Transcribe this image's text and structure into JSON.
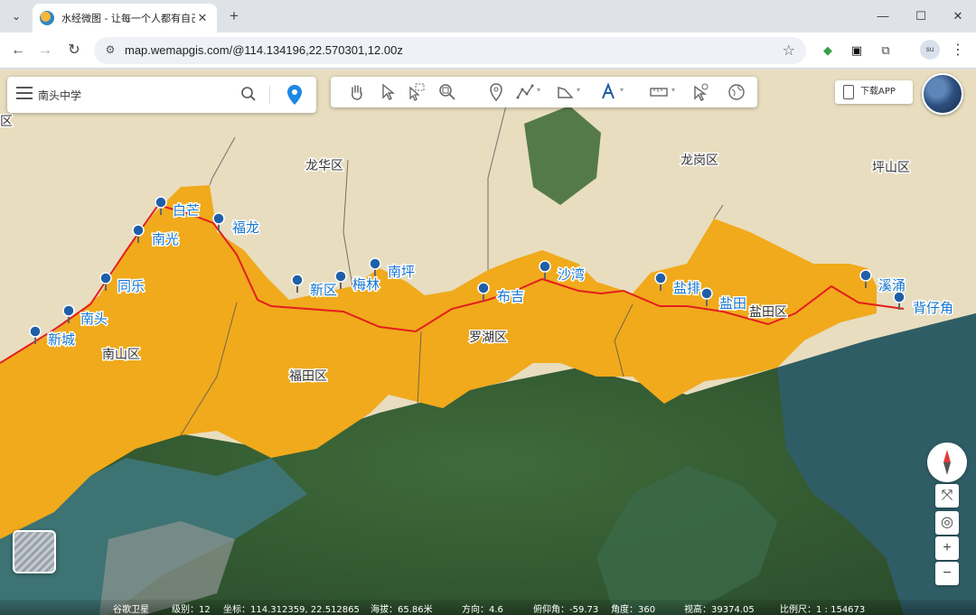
{
  "browser": {
    "tab_title": "水经微图 - 让每一个人都有自己",
    "url": "map.wemapgis.com/@114.134196,22.570301,12.00z",
    "profile_initials": "su"
  },
  "search": {
    "value": "南头中学"
  },
  "download_label": "下载APP",
  "districts": {
    "longhua": "龙华区",
    "longgang": "龙岗区",
    "pingshan": "坪山区",
    "nanshan": "南山区",
    "futian": "福田区",
    "luohu": "罗湖区",
    "yantian": "盐田区",
    "left_edge": "区"
  },
  "pois": {
    "baimang": "白芒",
    "nanguang": "南光",
    "fulong": "福龙",
    "tongle": "同乐",
    "nantou": "南头",
    "xincheng": "新城",
    "xinqu": "新区",
    "meilin": "梅林",
    "nanping": "南坪",
    "buji": "布吉",
    "shawan": "沙湾",
    "yanpai": "盐排",
    "yantian": "盐田",
    "xiyong": "溪涌",
    "beizaijiao": "背仔角"
  },
  "status": {
    "source": "谷歌卫星",
    "level_label": "级别：",
    "level": "12",
    "coord_label": "坐标：",
    "coords": "114.312359, 22.512865",
    "alt_label": "海拔：",
    "alt": "65.86米",
    "dir_label": "方向：",
    "dir": "4.6",
    "pitch_label": "俯仰角：",
    "pitch": "-59.73",
    "angle_label": "角度：",
    "angle": "360",
    "view_label": "视高：",
    "view": "39374.05",
    "scale_label": "比例尺：",
    "scale": "1 : 154673"
  }
}
